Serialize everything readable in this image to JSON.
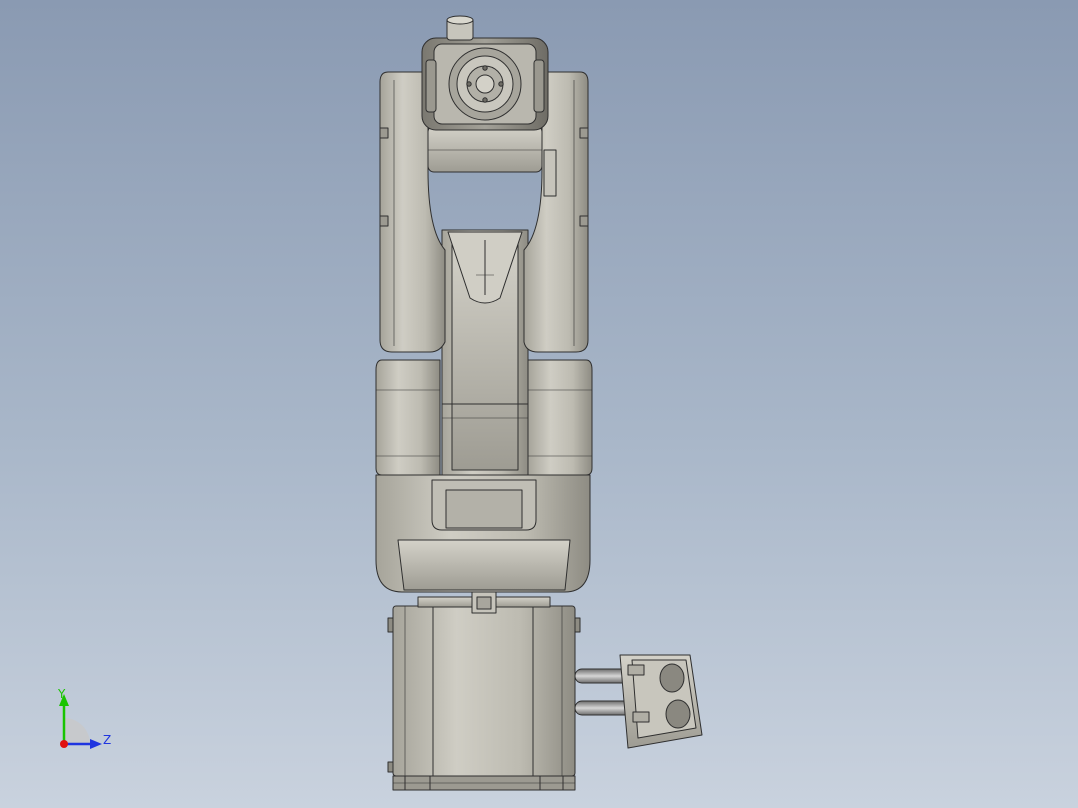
{
  "viewport": {
    "background_top": "#8a9ab2",
    "background_bottom": "#c9d2de"
  },
  "model": {
    "part_color": "#b7b5ab",
    "edge_color": "#2f2f2f",
    "hose_color": "#8f8f8f"
  },
  "triad": {
    "y_label": "Y",
    "z_label": "Z",
    "y_color": "#19c400",
    "z_color": "#1f35e0",
    "x_color": "#e01010"
  }
}
